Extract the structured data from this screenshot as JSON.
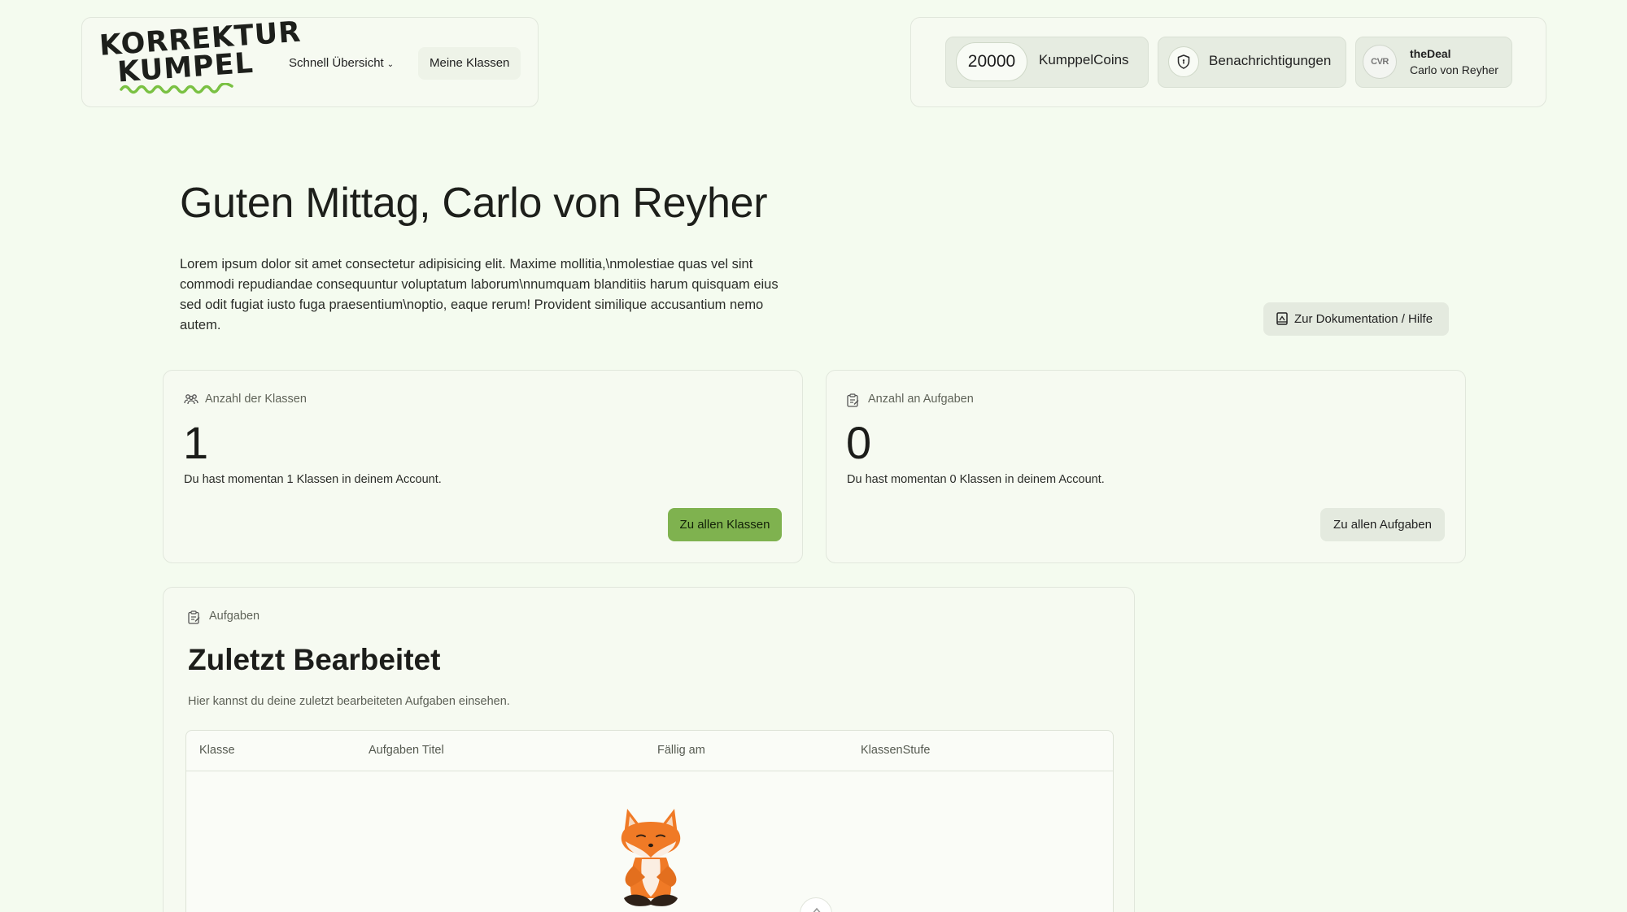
{
  "brand": {
    "logo_line1": "KORREKTUR",
    "logo_line2": "KUMPEL"
  },
  "nav": {
    "quick_overview": "Schnell Übersicht",
    "my_classes": "Meine Klassen"
  },
  "user": {
    "coins": "20000",
    "coins_label": "KumppelCoins",
    "notifications_label": "Benachrichtigungen",
    "avatar_text": "CVR",
    "username": "theDeal",
    "full_name": "Carlo von Reyher"
  },
  "hero": {
    "greeting": "Guten Mittag, Carlo von Reyher",
    "intro": "Lorem ipsum dolor sit amet consectetur adipisicing elit. Maxime mollitia,\\nmolestiae quas vel sint commodi repudiandae consequuntur voluptatum laborum\\nnumquam blanditiis harum quisquam eius sed odit fugiat iusto fuga praesentium\\noptio, eaque rerum! Provident similique accusantium nemo autem.",
    "docs_button": "Zur Dokumentation / Hilfe"
  },
  "stats": {
    "classes": {
      "caption": "Anzahl der Klassen",
      "count": "1",
      "description": "Du hast momentan 1 Klassen in deinem Account.",
      "button": "Zu allen Klassen"
    },
    "tasks": {
      "caption": "Anzahl an Aufgaben",
      "count": "0",
      "description": "Du hast momentan 0 Klassen in deinem Account.",
      "button": "Zu allen Aufgaben"
    }
  },
  "recent": {
    "caption": "Aufgaben",
    "title": "Zuletzt Bearbeitet",
    "subtitle": "Hier kannst du deine zuletzt bearbeiteten Aufgaben einsehen.",
    "columns": [
      "Klasse",
      "Aufgaben Titel",
      "Fällig am",
      "KlassenStufe"
    ]
  },
  "colors": {
    "background": "#f4fbef",
    "accent": "#7fb24f",
    "fox_orange": "#f07a26"
  },
  "icons": [
    "chevron-down-icon",
    "shield-icon",
    "book-icon",
    "users-icon",
    "clipboard-icon",
    "fox-mascot-icon",
    "chevron-up-icon"
  ]
}
